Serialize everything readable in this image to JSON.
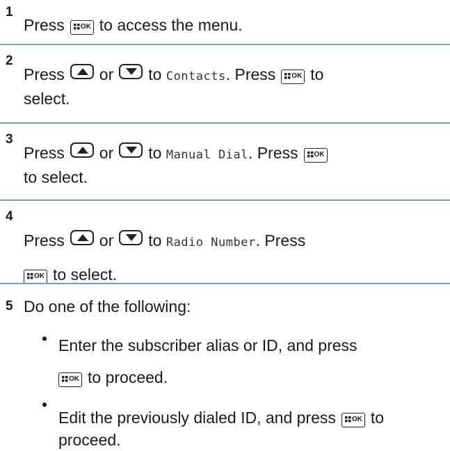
{
  "steps": [
    {
      "number": "1",
      "press": "Press",
      "after_ok": "to access the menu."
    },
    {
      "number": "2",
      "press": "Press",
      "or": "or",
      "to": "to",
      "item": "Contacts",
      "press2": ". Press",
      "to_end": "to",
      "select": "select."
    },
    {
      "number": "3",
      "press": "Press",
      "or": "or",
      "to": "to",
      "item": "Manual Dial",
      "press2": ". Press",
      "select": "to select."
    },
    {
      "number": "4",
      "press": "Press",
      "or": "or",
      "to": "to",
      "item": "Radio Number",
      "press2": ". Press",
      "select": "to select."
    },
    {
      "number": "5",
      "intro": "Do one of the following:",
      "bullets": [
        {
          "line1": "Enter the subscriber alias or ID, and press",
          "line2": "to proceed."
        },
        {
          "line1": "Edit the previously dialed ID, and press",
          "to": "to",
          "line2": "proceed."
        }
      ]
    }
  ],
  "keys": {
    "ok": "OK",
    "ok_icon": "menu-ok-key-icon",
    "up_icon": "up-arrow-key-icon",
    "down_icon": "down-arrow-key-icon"
  },
  "colors": {
    "divider": "#8096b4",
    "text": "#1a1a1a"
  }
}
